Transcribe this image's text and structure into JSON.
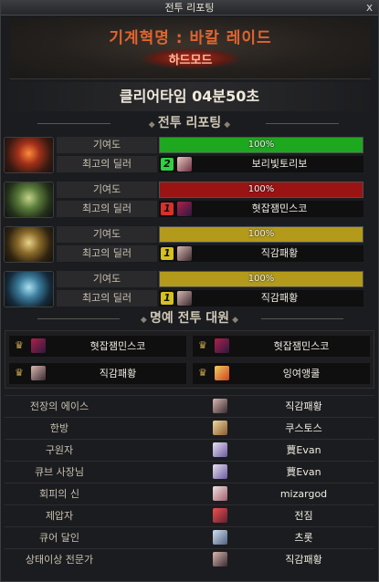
{
  "window": {
    "title": "전투 리포팅",
    "close": "x"
  },
  "raid": {
    "name": "기계혁명 : 바칼 레이드",
    "mode": "하드모드"
  },
  "clear_time": "클리어타임  04분50초",
  "report_section": "전투 리포팅",
  "labels": {
    "contribution": "기여도",
    "best_dealer": "최고의 딜러"
  },
  "parties": [
    {
      "color": "#1ea820",
      "contribution_pct": 100,
      "pct_text": "100%",
      "count": "2",
      "count_color": "#2fd142",
      "dealer": "보리빛토리보"
    },
    {
      "color": "#9a1414",
      "contribution_pct": 100,
      "pct_text": "100%",
      "count": "1",
      "count_color": "#d8302a",
      "dealer": "혓잡잼민스코"
    },
    {
      "color": "#b39a1a",
      "contribution_pct": 100,
      "pct_text": "100%",
      "count": "1",
      "count_color": "#d6c020",
      "dealer": "직감패황"
    },
    {
      "color": "#b39a1a",
      "contribution_pct": 100,
      "pct_text": "100%",
      "count": "1",
      "count_color": "#d6c020",
      "dealer": "직감패황"
    }
  ],
  "honor_section": "명예 전투 대원",
  "honor": [
    "혓잡잼민스코",
    "혓잡잼민스코",
    "직감패황",
    "잉여앵쿨"
  ],
  "awards": [
    {
      "title": "전장의 에이스",
      "player": "직감패황"
    },
    {
      "title": "한방",
      "player": "쿠스토스"
    },
    {
      "title": "구원자",
      "player": "蕒Evan"
    },
    {
      "title": "큐브 사장님",
      "player": "蕒Evan"
    },
    {
      "title": "회피의 신",
      "player": "mizargod"
    },
    {
      "title": "제압자",
      "player": "전짐"
    },
    {
      "title": "큐어 달인",
      "player": "츠롯"
    },
    {
      "title": "상태이상 전문가",
      "player": "직감패황"
    }
  ]
}
